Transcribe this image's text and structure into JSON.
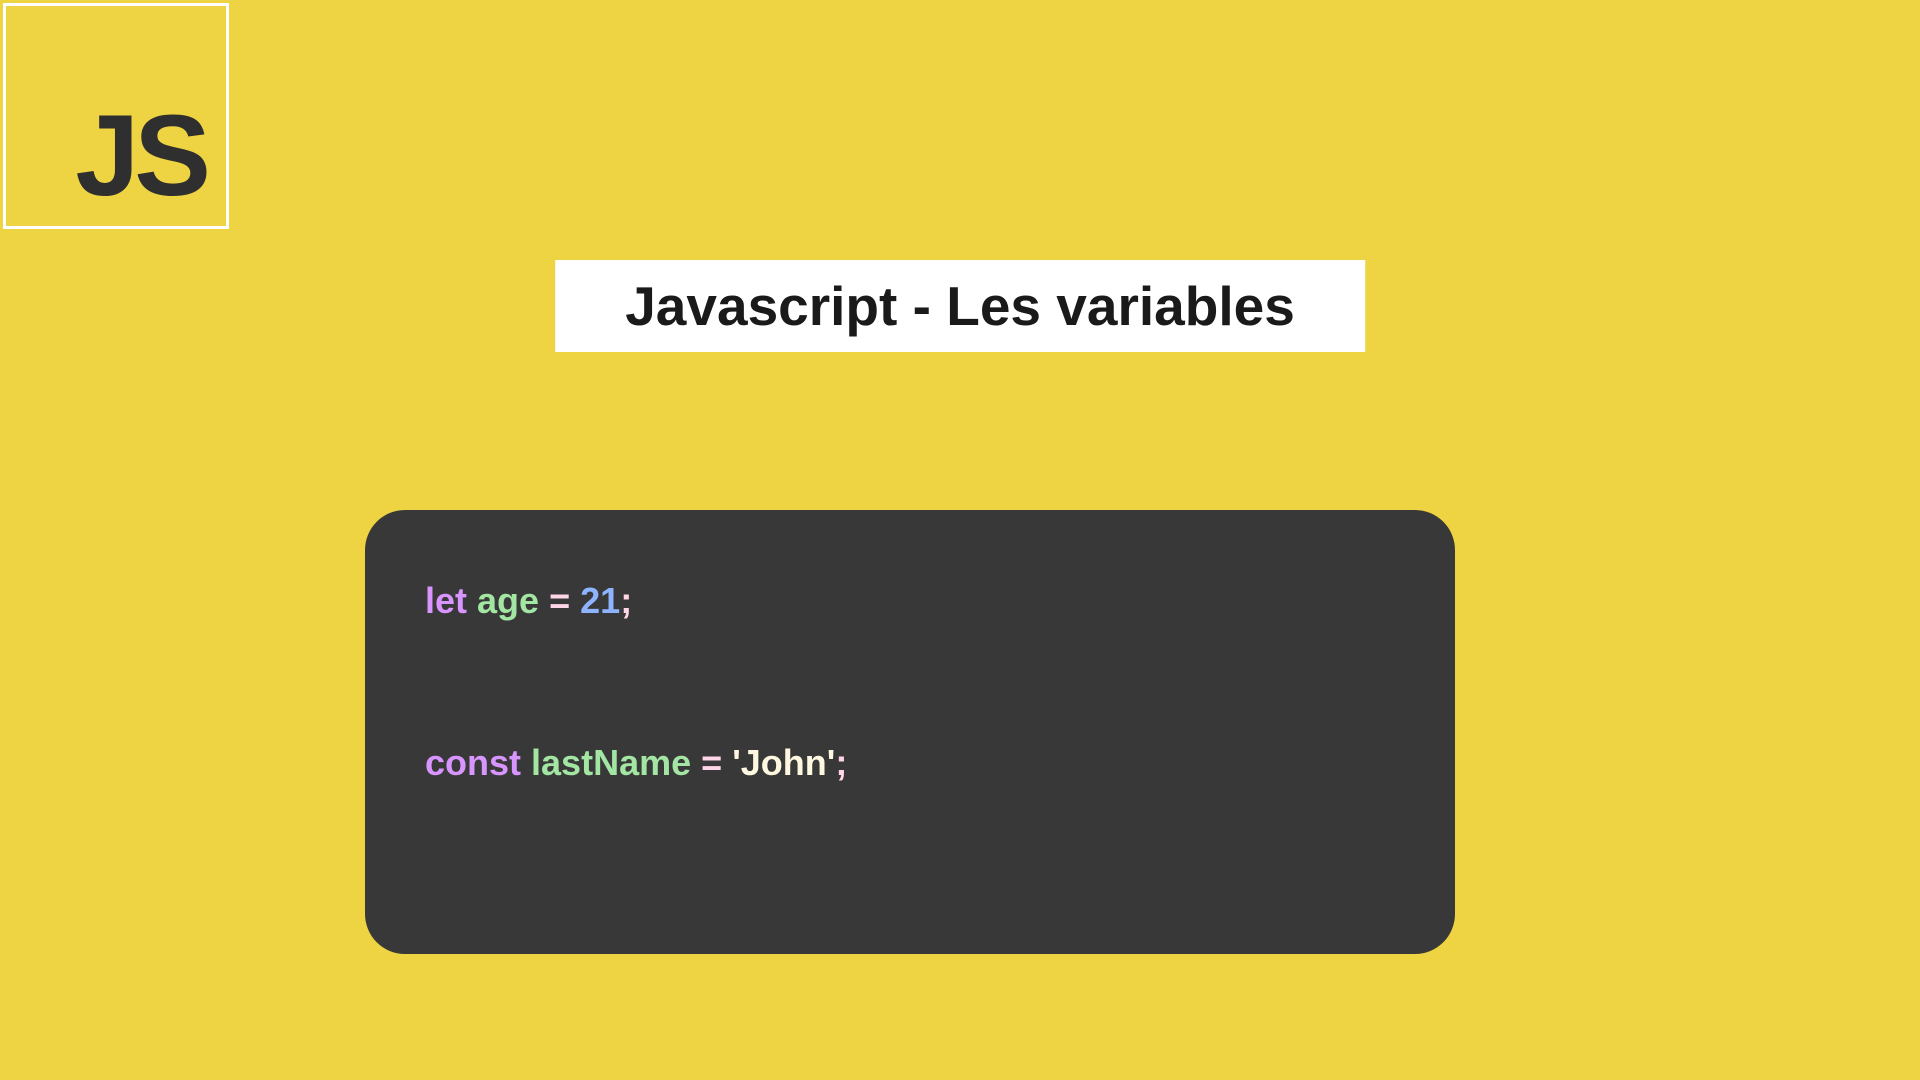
{
  "logo": {
    "text": "JS"
  },
  "title": "Javascript - Les variables",
  "code": {
    "line1": {
      "keyword": "let",
      "identifier": "age",
      "operator": "=",
      "value": "21",
      "punct": ";"
    },
    "line2": {
      "keyword": "const",
      "identifier": "lastName",
      "operator": "=",
      "value": "'John'",
      "punct": ";"
    }
  }
}
